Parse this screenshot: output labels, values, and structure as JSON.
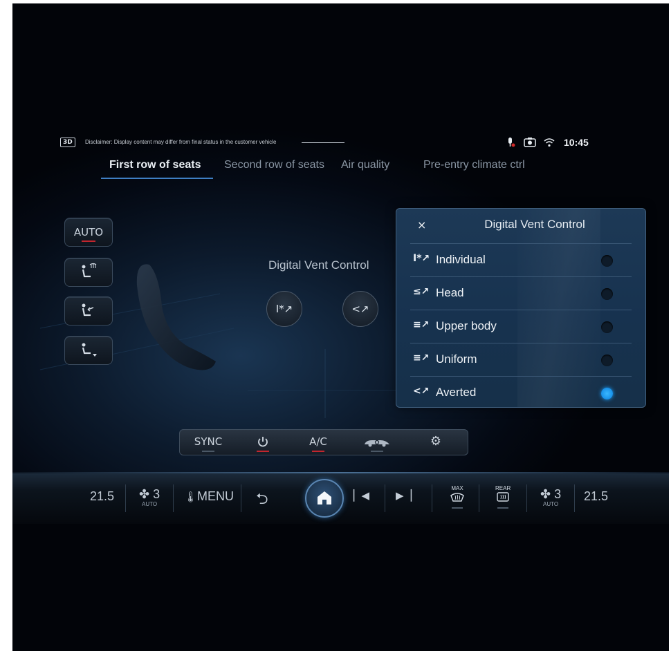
{
  "status": {
    "badge": "3D",
    "disclaimer": "Disclaimer: Display content may differ from final status in the customer vehicle",
    "icons": [
      "mic-muted-icon",
      "camera-icon",
      "wifi-icon"
    ],
    "time": "10:45"
  },
  "tabs": [
    {
      "label": "First row of seats",
      "active": true
    },
    {
      "label": "Second row of seats",
      "active": false
    },
    {
      "label": "Air quality",
      "active": false
    },
    {
      "label": "Pre-entry climate ctrl",
      "active": false
    }
  ],
  "side_buttons": [
    {
      "label": "AUTO",
      "icon": "auto-text"
    },
    {
      "label": "",
      "icon": "seat-windshield-icon"
    },
    {
      "label": "",
      "icon": "seat-vent-icon"
    },
    {
      "label": "",
      "icon": "seat-footwell-icon"
    }
  ],
  "center": {
    "title": "Digital Vent Control",
    "vent_left_icon": "individual-vent-icon",
    "vent_right_icon": "averted-vent-icon"
  },
  "panel": {
    "title": "Digital Vent Control",
    "close": "×",
    "options": [
      {
        "icon": "I*↗",
        "label": "Individual",
        "selected": false
      },
      {
        "icon": "≤↗",
        "label": "Head",
        "selected": false
      },
      {
        "icon": "≡↗",
        "label": "Upper body",
        "selected": false
      },
      {
        "icon": "≡↗",
        "label": "Uniform",
        "selected": false
      },
      {
        "icon": "<↗",
        "label": "Averted",
        "selected": true
      }
    ]
  },
  "controls": {
    "sync": "SYNC",
    "ac": "A/C"
  },
  "bottom": {
    "temp_left": "21.5",
    "fan_left": "3",
    "fan_left_sub": "AUTO",
    "menu": "MENU",
    "fan_right": "3",
    "fan_right_sub": "AUTO",
    "temp_right": "21.5",
    "defrost_label": "MAX",
    "rear_label": "REAR"
  },
  "colors": {
    "accent_blue": "#3f7fc4",
    "indicator_red": "#c2262e",
    "selected_radio": "#1890e8"
  }
}
